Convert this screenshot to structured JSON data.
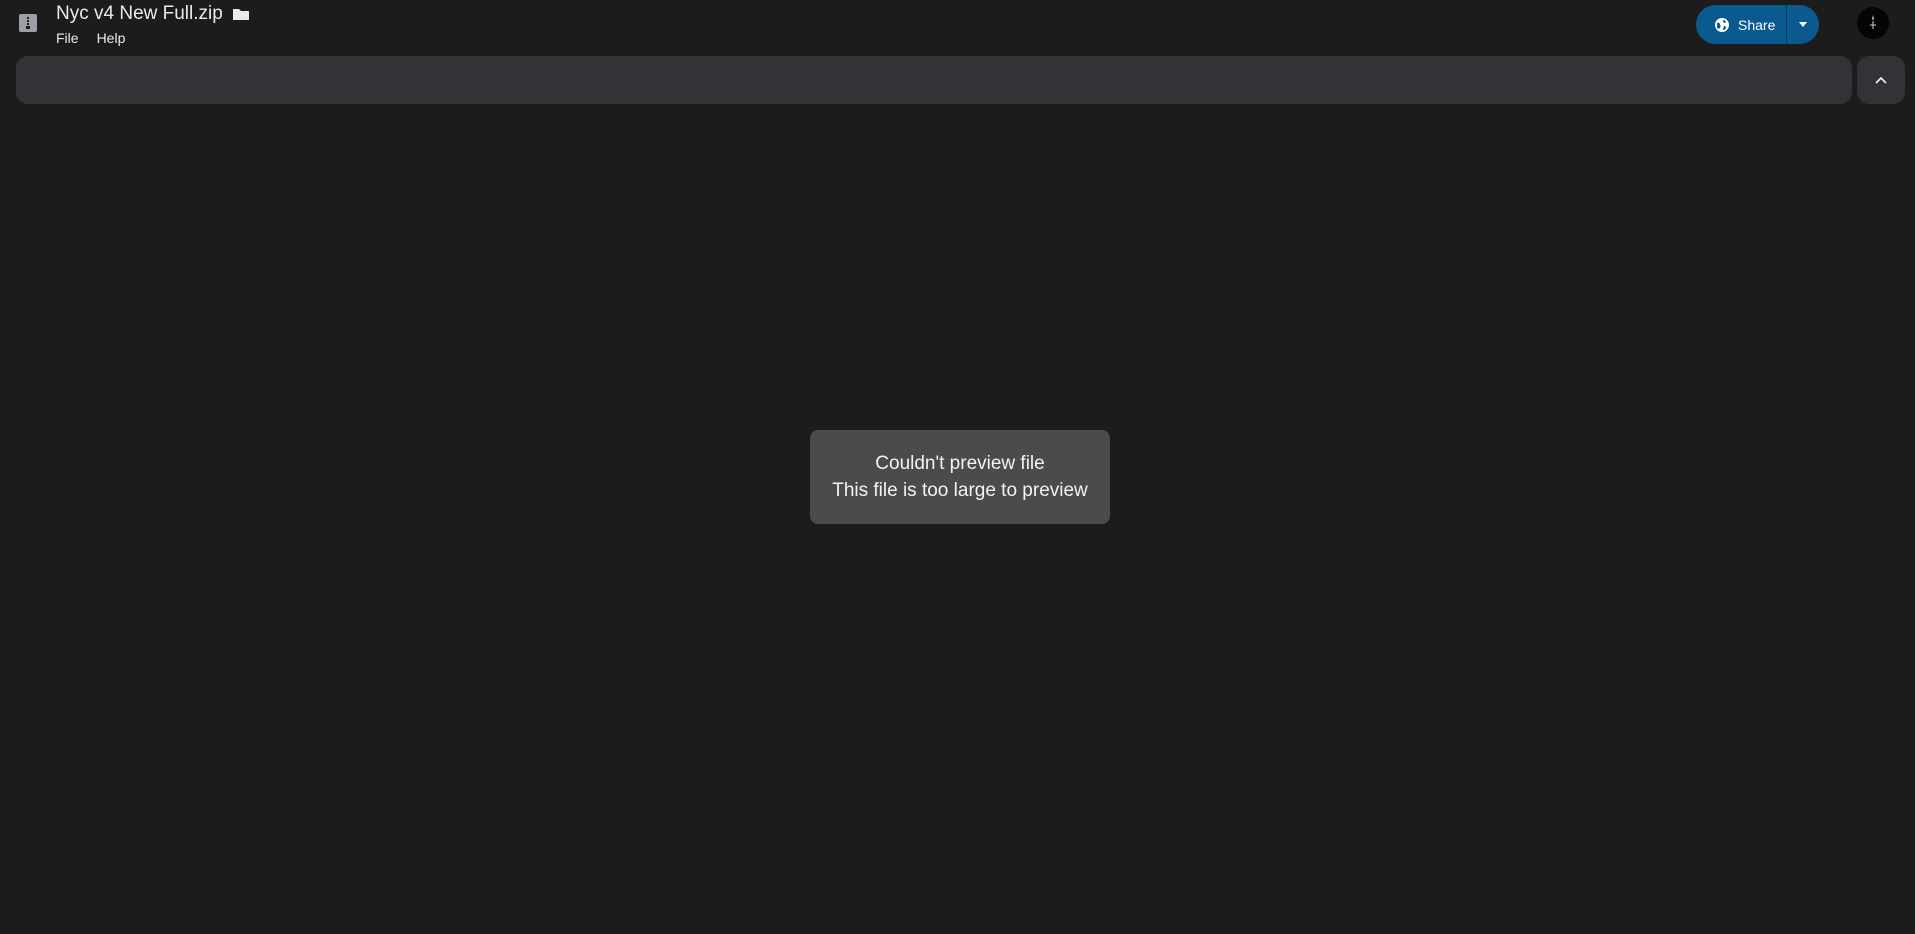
{
  "header": {
    "file_title": "Nyc v4 New Full.zip",
    "file_type_icon": "zip-archive-icon",
    "folder_icon": "folder-icon",
    "menu": [
      {
        "label": "File"
      },
      {
        "label": "Help"
      }
    ]
  },
  "share": {
    "label": "Share",
    "icon": "globe-icon",
    "dropdown_icon": "caret-down-icon",
    "color": "#0b5a8f"
  },
  "account": {
    "avatar_icon": "avatar"
  },
  "toolbar": {
    "collapse_icon": "chevron-up-icon"
  },
  "message": {
    "title": "Couldn't preview file",
    "detail": "This file is too large to preview"
  },
  "colors": {
    "background": "#1c1c1c",
    "bar": "#323336",
    "card": "#4b4a4c"
  }
}
